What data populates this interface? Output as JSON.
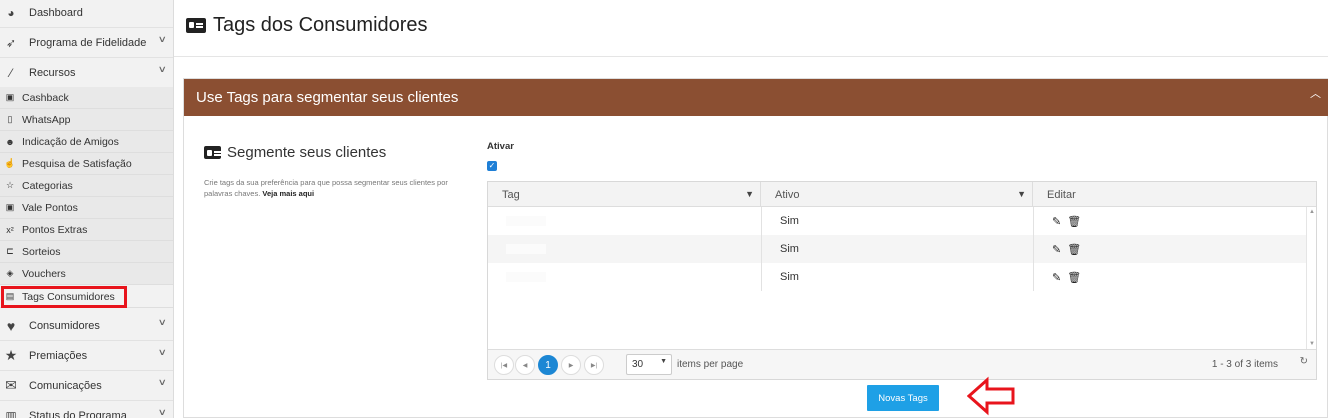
{
  "sidebar": {
    "items": [
      {
        "label": "Dashboard",
        "icon": "gauge-icon"
      },
      {
        "label": "Programa de Fidelidade",
        "icon": "rocket-icon"
      },
      {
        "label": "Recursos",
        "icon": "magic-wand-icon"
      },
      {
        "label": "Consumidores",
        "icon": "heart-icon"
      },
      {
        "label": "Premiações",
        "icon": "star-icon"
      },
      {
        "label": "Comunicações",
        "icon": "envelope-icon"
      },
      {
        "label": "Status do Programa",
        "icon": "chart-icon"
      }
    ],
    "sub_items": [
      {
        "label": "Cashback",
        "icon": "money-icon"
      },
      {
        "label": "WhatsApp",
        "icon": "phone-icon"
      },
      {
        "label": "Indicação de Amigos",
        "icon": "users-icon"
      },
      {
        "label": "Pesquisa de Satisfação",
        "icon": "thumbs-up-icon"
      },
      {
        "label": "Categorias",
        "icon": "star-half-icon"
      },
      {
        "label": "Vale Pontos",
        "icon": "money-icon"
      },
      {
        "label": "Pontos Extras",
        "icon": "superscript-icon"
      },
      {
        "label": "Sorteios",
        "icon": "ticket-icon"
      },
      {
        "label": "Vouchers",
        "icon": "tag-icon"
      },
      {
        "label": "Tags Consumidores",
        "icon": "id-card-icon"
      }
    ]
  },
  "header": {
    "title": "Tags dos Consumidores"
  },
  "panel": {
    "title": "Use Tags para segmentar seus clientes",
    "section_title": "Segmente seus clientes",
    "description": "Crie tags da sua preferência para que possa segmentar seus clientes por palavras chaves.",
    "description_link": "Veja mais aqui",
    "ativar_label": "Ativar",
    "ativar_checked": true
  },
  "grid": {
    "columns": [
      "Tag",
      "Ativo",
      "Editar"
    ],
    "rows": [
      {
        "tag": "",
        "ativo": "Sim"
      },
      {
        "tag": "",
        "ativo": "Sim"
      },
      {
        "tag": "",
        "ativo": "Sim"
      }
    ],
    "pager": {
      "current_page": "1",
      "page_size": "30",
      "items_per_page_label": "items per page",
      "info": "1 - 3 of 3 items"
    }
  },
  "actions": {
    "new_tag_label": "Novas Tags"
  },
  "colors": {
    "panel_header": "#8b4f32",
    "primary_button": "#1ea0e6",
    "highlight": "#e8141c",
    "pager_active": "#1c87d4"
  }
}
